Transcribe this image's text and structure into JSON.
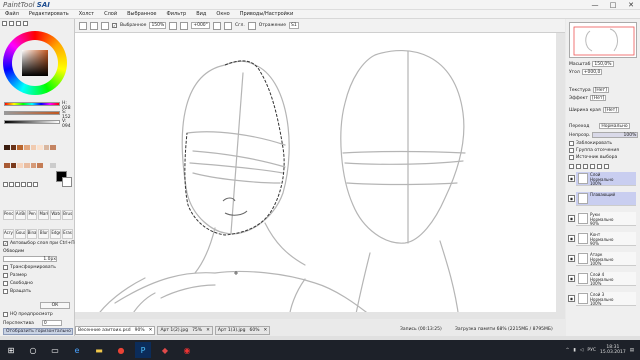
{
  "window": {
    "logo_prefix": "PaintTool",
    "logo_main": "SAI",
    "minimize": "—",
    "maximize": "□",
    "close": "✕"
  },
  "menu": [
    "Файл",
    "Редактировать",
    "Холст",
    "Слой",
    "Выбранное",
    "Фильтр",
    "Вид",
    "Окно",
    "Приводы/Настройки"
  ],
  "options": {
    "selection_label": "Выбранное",
    "zoom": "150%",
    "angle": "+000°",
    "mode_label": "Сгл.",
    "stab_label": "Отражение",
    "stab_value": "S1"
  },
  "color_panel": {
    "h_label": "H",
    "h_value": "028",
    "s_label": "S",
    "s_value": "152",
    "v_label": "V",
    "v_value": "094",
    "swatch_colors": [
      "#3b1d10",
      "#6a3217",
      "#b8652d",
      "#e2a67d",
      "#f1cbb0",
      "#fbe2cf",
      "#d9b7a0",
      "#c48462",
      "#a85a34",
      "#7a3a1c",
      "#f6d4bd",
      "#e9bca0",
      "#d59a78",
      "#c47c55",
      "#f0f0f0",
      "#cccccc"
    ]
  },
  "tools": {
    "items": [
      "Pencil",
      "AirBr",
      "Pen",
      "Marker",
      "Water",
      "Brush",
      "Acrylic",
      "Gouache",
      "Binary",
      "Blur",
      "Edge",
      "Eraser"
    ],
    "sizes": [
      "28",
      "46",
      "0.7",
      "66",
      "16",
      "20"
    ]
  },
  "left_options": {
    "antialias": "Автовыбор слоя при Ctrl+Перетаскив",
    "scale_label": "Обводим",
    "scale_value": "1.0px",
    "transform": "Трансформировать",
    "resize": "Размер",
    "free": "Свободно",
    "rotate": "Вращать",
    "ok": "ОК",
    "hq": "HQ предпросмотр",
    "angle_label": "Перспектива",
    "angle_value": "0",
    "btn1": "Отобразить горизонтально",
    "btn2": "Отобразить вертикально"
  },
  "navigator": {
    "zoom_label": "Масштаб",
    "zoom_value": "150,0%",
    "angle_label": "Угол",
    "angle_value": "+000,0"
  },
  "right_props": {
    "texture_label": "Текстура",
    "texture_value": "[Нет]",
    "effect_label": "Эффект",
    "effect_value": "[Нет]",
    "width_label": "Ширина края",
    "width_value": "[Нет]",
    "mode_label": "Переход",
    "mode_value": "Нормально",
    "opacity_label": "Непрозр.",
    "opacity_value": "100%",
    "chk1": "Заблокировать",
    "chk2": "Группа отсечения",
    "chk3": "Источник выбора"
  },
  "layers": [
    {
      "name": "Слой",
      "mode": "Нормально",
      "pct": "100%",
      "selected": true
    },
    {
      "name": "Плавающий",
      "mode": "",
      "pct": "",
      "selected": true
    },
    {
      "name": "Руки",
      "mode": "Нормально",
      "pct": "90%",
      "selected": false
    },
    {
      "name": "Конт",
      "mode": "Нормально",
      "pct": "90%",
      "selected": false
    },
    {
      "name": "Атарк",
      "mode": "Нормально",
      "pct": "100%",
      "selected": false
    },
    {
      "name": "Cлой 4",
      "mode": "Нормально",
      "pct": "100%",
      "selected": false
    },
    {
      "name": "Слой 3",
      "mode": "Нормально",
      "pct": "100%",
      "selected": false
    }
  ],
  "doc_tabs": [
    {
      "name": "Весенние азитоиx.psd",
      "zoom": "90%",
      "active": true
    },
    {
      "name": "Арт 1(2).jpg",
      "zoom": "75%",
      "active": false
    },
    {
      "name": "Арт 1(3).jpg",
      "zoom": "60%",
      "active": false
    }
  ],
  "status": {
    "recording": "Запись (00:13:25)",
    "memory": "Загрузка памяти 68% (2215МБ / 8795МБ)",
    "lang": "РУС",
    "time": "18:31",
    "date": "15.03.2017"
  }
}
